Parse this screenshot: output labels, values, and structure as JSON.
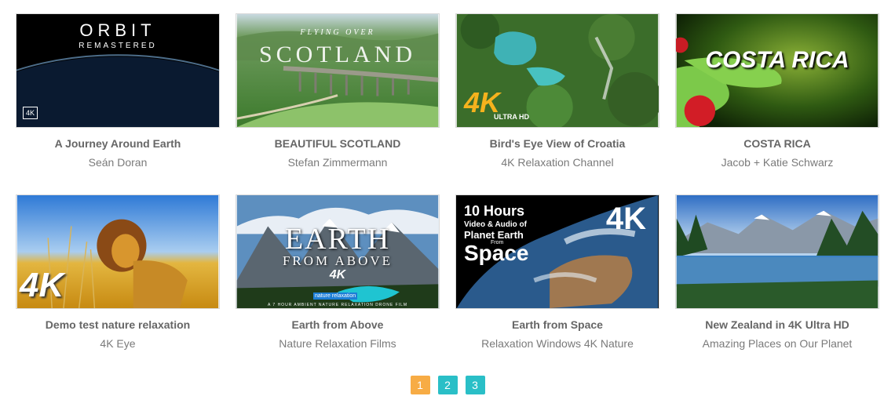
{
  "videos": [
    {
      "title": "A Journey Around Earth",
      "author": "Seán Doran",
      "overlay_main": "ORBIT",
      "overlay_sub": "REMASTERED",
      "badge": "4K"
    },
    {
      "title": "BEAUTIFUL SCOTLAND",
      "author": "Stefan Zimmermann",
      "overlay_main": "SCOTLAND",
      "overlay_sub": "FLYING OVER"
    },
    {
      "title": "Bird's Eye View of Croatia",
      "author": "4K Relaxation Channel",
      "overlay_main": "4K",
      "overlay_sub": "ULTRA HD"
    },
    {
      "title": "COSTA RICA",
      "author": "Jacob + Katie Schwarz",
      "overlay_main": "COSTA RICA"
    },
    {
      "title": "Demo test nature relaxation",
      "author": "4K Eye",
      "overlay_main": "4K"
    },
    {
      "title": "Earth from Above",
      "author": "Nature Relaxation Films",
      "overlay_main": "EARTH",
      "overlay_sub": "FROM ABOVE",
      "badge": "4K",
      "brand": "nature relaxation",
      "footer": "A 7 HOUR AMBIENT NATURE RELAXATION DRONE FILM"
    },
    {
      "title": "Earth from Space",
      "author": "Relaxation Windows 4K Nature",
      "overlay_main": "10 Hours",
      "overlay_sub": "Video & Audio of",
      "overlay_sub2": "Planet Earth",
      "overlay_from": "From",
      "overlay_space": "Space",
      "badge": "4K"
    },
    {
      "title": "New Zealand in 4K Ultra HD",
      "author": "Amazing Places on Our Planet"
    }
  ],
  "pagination": {
    "pages": [
      "1",
      "2",
      "3"
    ],
    "active_color": "#f7ac45",
    "inactive_color": "#2abfc7"
  }
}
